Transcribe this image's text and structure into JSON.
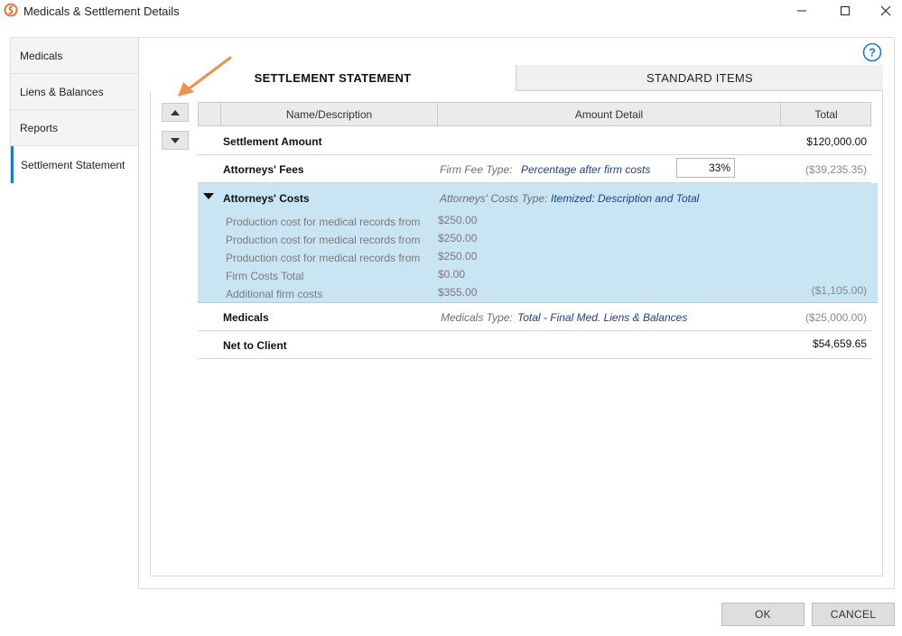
{
  "window": {
    "title": "Medicals & Settlement Details",
    "icons": {
      "app": "app-logo-icon",
      "minimize": "minimize-icon",
      "maximize": "maximize-icon",
      "close": "close-icon"
    }
  },
  "nav": {
    "items": [
      {
        "label": "Medicals",
        "active": false
      },
      {
        "label": "Liens & Balances",
        "active": false
      },
      {
        "label": "Reports",
        "active": false
      },
      {
        "label": "Settlement Statement",
        "active": true
      }
    ],
    "accent": "#1e78d6"
  },
  "help": {
    "glyph": "?"
  },
  "tabs": [
    {
      "label": "SETTLEMENT STATEMENT",
      "active": true
    },
    {
      "label": "STANDARD ITEMS",
      "active": false
    }
  ],
  "table": {
    "headers": {
      "name": "Name/Description",
      "amount": "Amount Detail",
      "total": "Total"
    },
    "settlement": {
      "label": "Settlement Amount",
      "total": "$120,000.00"
    },
    "fees": {
      "label": "Attorneys' Fees",
      "type_label": "Firm Fee Type:",
      "type_value": "Percentage after firm costs",
      "percent": "33%",
      "total": "($39,235.35)"
    },
    "costs": {
      "label": "Attorneys' Costs",
      "type_label": "Attorneys' Costs Type:",
      "type_value": "Itemized: Description and Total",
      "items": [
        {
          "desc": "Production cost for medical records from",
          "amount": "$250.00"
        },
        {
          "desc": "Production cost for medical records from",
          "amount": "$250.00"
        },
        {
          "desc": "Production cost for medical records from",
          "amount": "$250.00"
        },
        {
          "desc": "Firm Costs Total",
          "amount": "$0.00"
        },
        {
          "desc": "Additional firm costs",
          "amount": "$355.00"
        }
      ],
      "total": "($1,105.00)",
      "highlight": "#c9e4f3"
    },
    "medicals": {
      "label": "Medicals",
      "type_label": "Medicals Type:",
      "type_value": "Total - Final Med. Liens & Balances",
      "total": "($25,000.00)"
    },
    "net": {
      "label": "Net to Client",
      "total": "$54,659.65"
    }
  },
  "footer": {
    "ok_label": "OK",
    "cancel_label": "CANCEL"
  },
  "annotation": {
    "color": "#f0924a"
  }
}
